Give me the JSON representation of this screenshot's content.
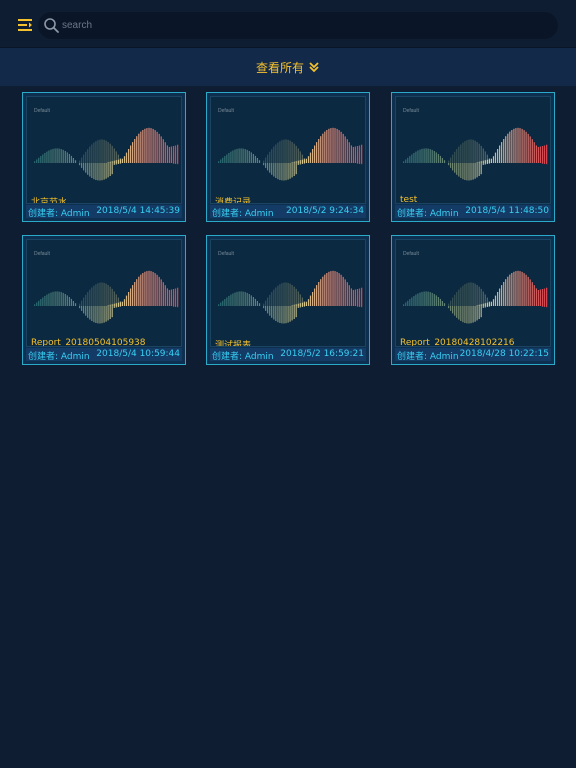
{
  "header": {
    "search_placeholder": "search",
    "menu_icon": "menu-icon",
    "search_icon": "search-icon"
  },
  "view_all": {
    "label": "查看所有",
    "icon": "double-chevron-down-icon"
  },
  "colors": {
    "accent_gold": "#f5c12d",
    "accent_cyan": "#38d0f2",
    "background": "#0f1d33"
  },
  "cards": [
    {
      "name": "北京节水",
      "creator": "创建者: Admin",
      "date": "2018/5/4 14:45:39",
      "thumb_label": "Default"
    },
    {
      "name": "消费记录",
      "creator": "创建者: Admin",
      "date": "2018/5/2 9:24:34",
      "thumb_label": "Default"
    },
    {
      "name": "test",
      "creator": "创建者: Admin",
      "date": "2018/5/4 11:48:50",
      "thumb_label": "Default"
    },
    {
      "name": "Report_20180504105938",
      "creator": "创建者: Admin",
      "date": "2018/5/4 10:59:44",
      "thumb_label": "Default"
    },
    {
      "name": "测试报表",
      "creator": "创建者: Admin",
      "date": "2018/5/2 16:59:21",
      "thumb_label": "Default"
    },
    {
      "name": "Report_20180428102216",
      "creator": "创建者: Admin",
      "date": "2018/4/28 10:22:15",
      "thumb_label": "Default"
    }
  ]
}
